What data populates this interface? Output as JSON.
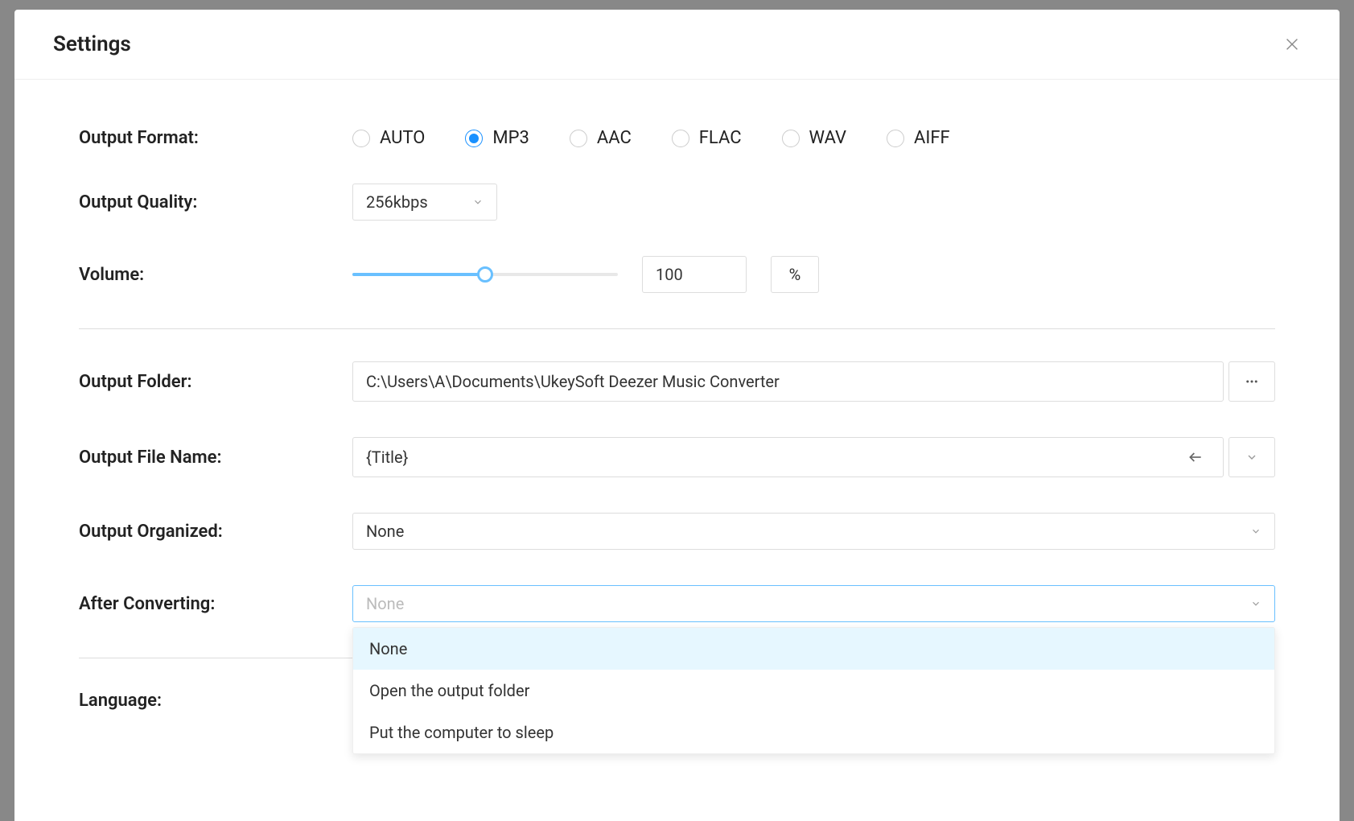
{
  "modal": {
    "title": "Settings"
  },
  "outputFormat": {
    "label": "Output Format:",
    "options": [
      "AUTO",
      "MP3",
      "AAC",
      "FLAC",
      "WAV",
      "AIFF"
    ],
    "selected": "MP3"
  },
  "outputQuality": {
    "label": "Output Quality:",
    "value": "256kbps"
  },
  "volume": {
    "label": "Volume:",
    "value": "100",
    "unit": "%",
    "percent": 50
  },
  "outputFolder": {
    "label": "Output Folder:",
    "value": "C:\\Users\\A\\Documents\\UkeySoft Deezer Music Converter"
  },
  "outputFileName": {
    "label": "Output File Name:",
    "value": "{Title}"
  },
  "outputOrganized": {
    "label": "Output Organized:",
    "value": "None"
  },
  "afterConverting": {
    "label": "After Converting:",
    "placeholder": "None",
    "options": [
      "None",
      "Open the output folder",
      "Put the computer to sleep"
    ],
    "selectedIndex": 0
  },
  "language": {
    "label": "Language:"
  }
}
